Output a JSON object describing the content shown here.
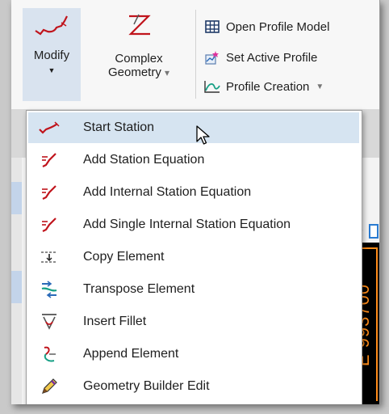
{
  "ribbon": {
    "modify": {
      "label": "Modify",
      "caret": "▼"
    },
    "complex": {
      "label_line1": "Complex",
      "label_line2": "Geometry",
      "caret": "▾"
    },
    "open_profile_model": "Open Profile Model",
    "set_active_profile": "Set Active Profile",
    "profile_creation": "Profile Creation",
    "profile_creation_caret": "▼"
  },
  "menu": {
    "items": [
      {
        "label": "Start Station",
        "icon": "start-station-icon"
      },
      {
        "label": "Add Station Equation",
        "icon": "add-station-equation-icon"
      },
      {
        "label": "Add Internal Station Equation",
        "icon": "add-internal-station-equation-icon"
      },
      {
        "label": "Add Single Internal Station Equation",
        "icon": "add-single-internal-station-equation-icon"
      },
      {
        "label": "Copy Element",
        "icon": "copy-element-icon"
      },
      {
        "label": "Transpose Element",
        "icon": "transpose-element-icon"
      },
      {
        "label": "Insert Fillet",
        "icon": "insert-fillet-icon"
      },
      {
        "label": "Append Element",
        "icon": "append-element-icon"
      },
      {
        "label": "Geometry Builder Edit",
        "icon": "geometry-builder-edit-icon"
      }
    ],
    "selected_index": 0
  },
  "canvas": {
    "coordinate_text": "E 993700"
  },
  "colors": {
    "accent_red": "#c0141c",
    "canvas_orange": "#ff8c1a",
    "selection": "#d6e4f1"
  }
}
